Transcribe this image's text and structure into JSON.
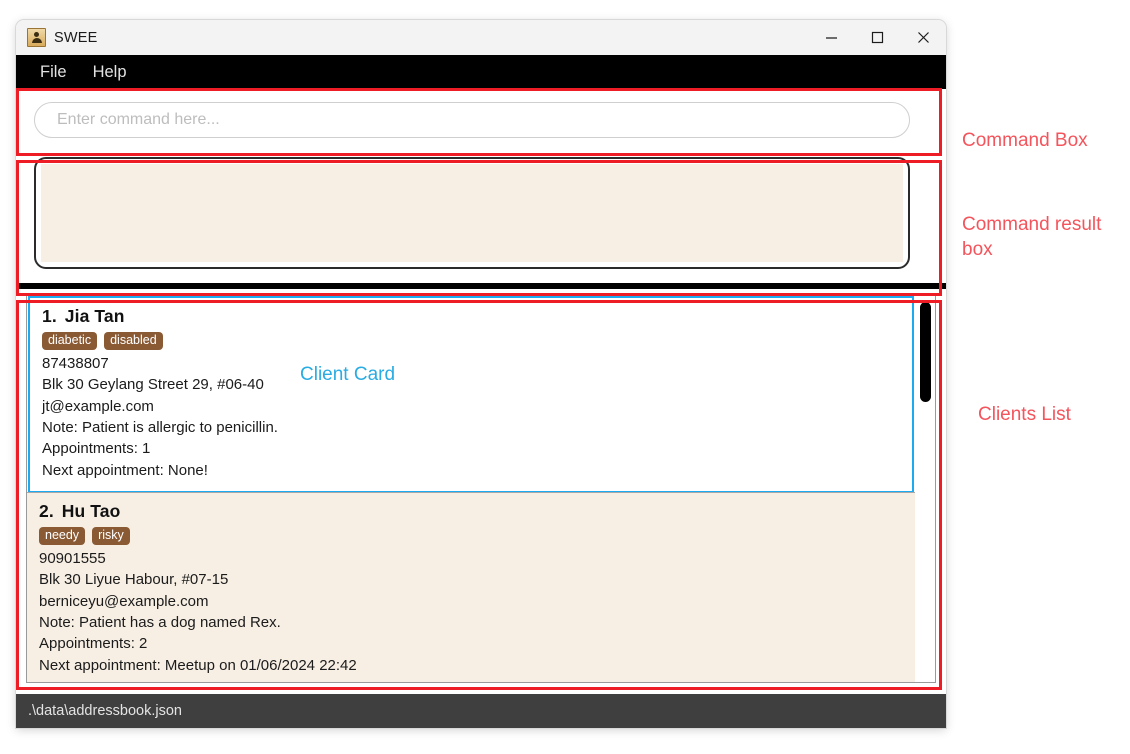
{
  "window": {
    "title": "SWEE",
    "icon": "person-icon",
    "controls": {
      "minimize": "minimize-icon",
      "maximize": "maximize-icon",
      "close": "close-icon"
    }
  },
  "menu": {
    "items": [
      {
        "label": "File"
      },
      {
        "label": "Help"
      }
    ]
  },
  "command": {
    "placeholder": "Enter command here...",
    "value": ""
  },
  "result": {
    "text": ""
  },
  "clients": [
    {
      "index": "1.",
      "name": "Jia Tan",
      "tags": [
        "diabetic",
        "disabled"
      ],
      "phone": "87438807",
      "address": "Blk 30 Geylang Street 29, #06-40",
      "email": "jt@example.com",
      "note": "Note: Patient is allergic to penicillin.",
      "appointments": "Appointments: 1",
      "next_appointment": "Next appointment: None!",
      "selected": true
    },
    {
      "index": "2.",
      "name": "Hu Tao",
      "tags": [
        "needy",
        "risky"
      ],
      "phone": "90901555",
      "address": "Blk 30 Liyue Habour, #07-15",
      "email": "berniceyu@example.com",
      "note": "Note: Patient has a dog named Rex.",
      "appointments": "Appointments: 2",
      "next_appointment": "Next appointment: Meetup on 01/06/2024 22:42",
      "selected": false
    }
  ],
  "status": {
    "file_path": ".\\data\\addressbook.json"
  },
  "annotations": {
    "command_box": "Command Box",
    "command_result_box": "Command result\nbox",
    "clients_list": "Clients List",
    "client_card": "Client Card",
    "box_color": "#ee1c25",
    "label_color": "#f4545c",
    "card_label_color": "#29ace3"
  },
  "colors": {
    "menu_bar": "#000000",
    "tag": "#8a5a35",
    "card_background": "#f7efe4",
    "selected_card_border": "#1eaaf1",
    "status_bar": "#3f3f3f",
    "result_fill": "#f7efe4"
  }
}
